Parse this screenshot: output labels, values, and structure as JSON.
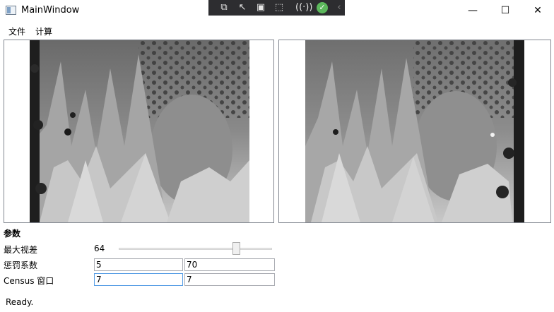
{
  "window": {
    "title": "MainWindow"
  },
  "devtools": {
    "icons": [
      "select-element-icon",
      "pointer-icon",
      "layout-adorner-icon",
      "track-focus-icon",
      "binding-failures-icon",
      "check-icon",
      "collapse-chevron-icon"
    ]
  },
  "menu": {
    "items": [
      {
        "label": "文件"
      },
      {
        "label": "计算"
      }
    ]
  },
  "params": {
    "section_title": "参数",
    "max_disparity": {
      "label": "最大视差",
      "value": "64",
      "slider_fraction": 0.78
    },
    "penalty": {
      "label": "惩罚系数",
      "p1": "5",
      "p2": "70"
    },
    "census": {
      "label": "Census 窗口",
      "w": "7",
      "h": "7"
    }
  },
  "status": {
    "text": "Ready."
  },
  "colors": {
    "accent_focus": "#569de5",
    "devbar_bg": "#2d2d30"
  }
}
